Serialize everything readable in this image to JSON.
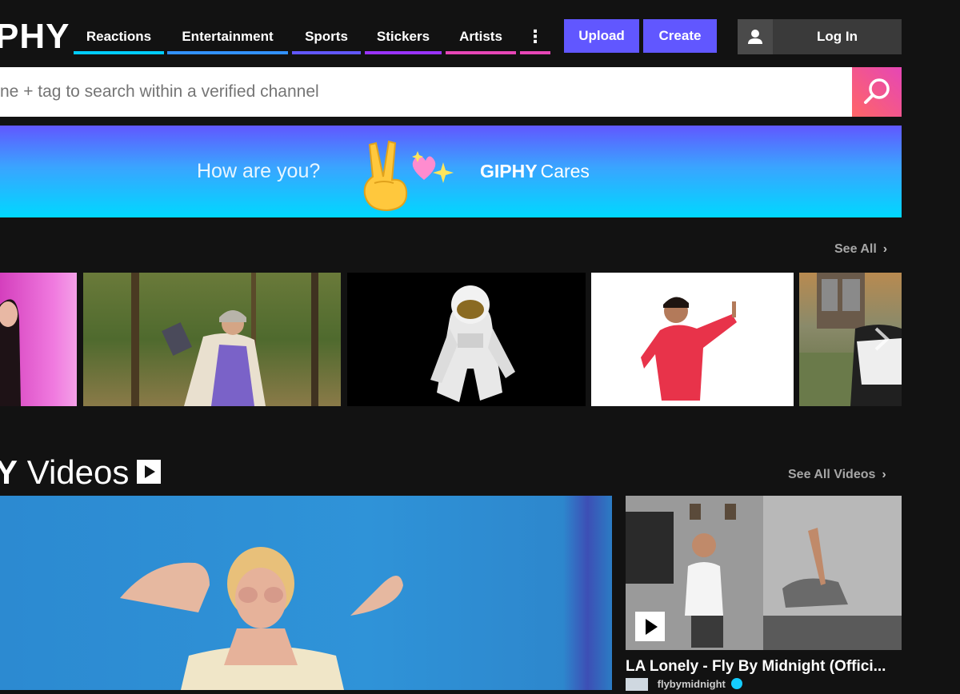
{
  "header": {
    "logo_text": "PHY",
    "nav": [
      {
        "label": "Reactions",
        "color": "#00ccff"
      },
      {
        "label": "Entertainment",
        "color": "#3191ff"
      },
      {
        "label": "Sports",
        "color": "#6157ff"
      },
      {
        "label": "Stickers",
        "color": "#9933ff"
      },
      {
        "label": "Artists",
        "color": "#e646b6"
      },
      {
        "label": "⋮",
        "color": "#e646b6"
      }
    ],
    "upload_label": "Upload",
    "create_label": "Create",
    "login_label": "Log In"
  },
  "search": {
    "placeholder": "ne + tag to search within a verified channel"
  },
  "banner": {
    "question": "How are you?",
    "brand_bold": "GIPHY",
    "brand_light": "Cares"
  },
  "trending": {
    "see_all_label": "See All"
  },
  "videos": {
    "title_partial": "Y",
    "title": "Videos",
    "see_all_label": "See All Videos",
    "side_title": "LA Lonely - Fly By Midnight (Offici...",
    "side_user": "flybymidnight"
  }
}
